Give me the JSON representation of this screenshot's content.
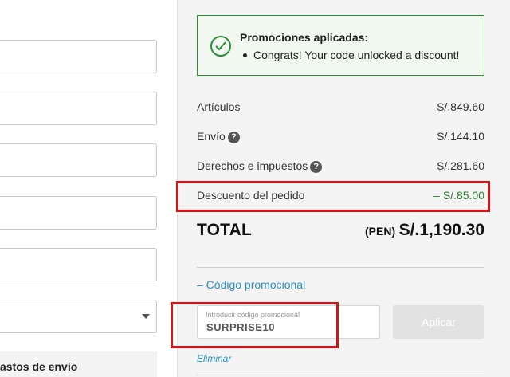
{
  "form": {
    "shipping_label": "astos de envío"
  },
  "promotions": {
    "title": "Promociones aplicadas:",
    "message": "Congrats! Your code unlocked a discount!",
    "success_color": "#2e8b3a"
  },
  "summary": {
    "items_label": "Artículos",
    "items_value": "S/.849.60",
    "shipping_label": "Envío",
    "shipping_value": "S/.144.10",
    "duties_label": "Derechos e impuestos",
    "duties_value": "S/.281.60",
    "discount_label": "Descuento del pedido",
    "discount_value": "– S/.85.00",
    "help_icon": "?",
    "total_label": "TOTAL",
    "total_currency": "(PEN)",
    "total_value": "S/.1,190.30"
  },
  "promo_code": {
    "toggle_label": "– Código promocional",
    "placeholder": "Introducir código promocional",
    "value": "SURPRISE10",
    "apply_label": "Aplicar",
    "remove_label": "Eliminar"
  },
  "colors": {
    "highlight_frame": "#d0161b",
    "link": "#2a8fc4",
    "discount": "#2e7d32"
  }
}
